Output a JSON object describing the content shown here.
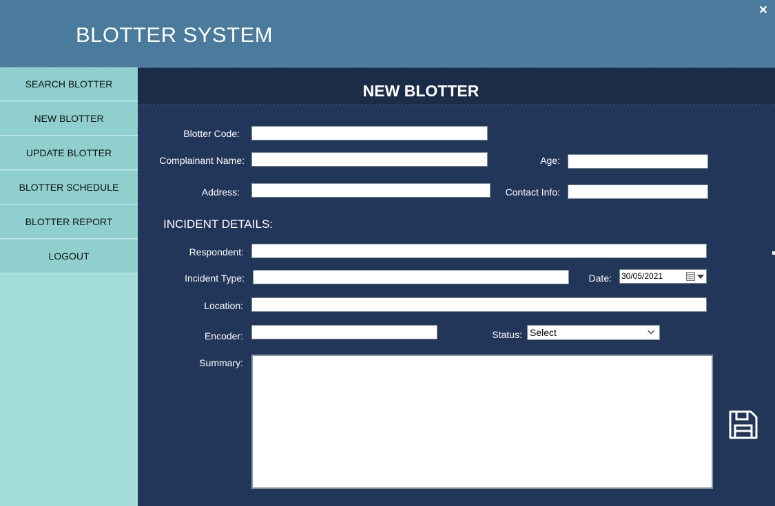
{
  "app": {
    "title": "BLOTTER SYSTEM",
    "close_label": "×"
  },
  "sidebar": {
    "items": [
      {
        "label": "SEARCH BLOTTER"
      },
      {
        "label": "NEW BLOTTER"
      },
      {
        "label": "UPDATE BLOTTER"
      },
      {
        "label": "BLOTTER SCHEDULE"
      },
      {
        "label": "BLOTTER REPORT"
      },
      {
        "label": "LOGOUT"
      }
    ]
  },
  "page": {
    "title": "NEW BLOTTER"
  },
  "form": {
    "blotter_code": {
      "label": "Blotter Code:",
      "value": ""
    },
    "complainant_name": {
      "label": "Complainant Name:",
      "value": ""
    },
    "age": {
      "label": "Age:",
      "value": ""
    },
    "address": {
      "label": "Address:",
      "value": ""
    },
    "contact_info": {
      "label": "Contact Info:",
      "value": ""
    },
    "incident_heading": "INCIDENT DETAILS:",
    "respondent": {
      "label": "Respondent:",
      "value": ""
    },
    "incident_type": {
      "label": "Incident Type:",
      "value": ""
    },
    "date": {
      "label": "Date:",
      "value": "30/05/2021"
    },
    "location": {
      "label": "Location:",
      "value": ""
    },
    "encoder": {
      "label": "Encoder:",
      "value": ""
    },
    "status": {
      "label": "Status:",
      "value": "Select"
    },
    "summary": {
      "label": "Summary:",
      "value": ""
    }
  },
  "icons": {
    "save": "floppy-disk-icon",
    "calendar": "calendar-icon",
    "dropdown": "chevron-down-icon",
    "close": "close-icon"
  },
  "colors": {
    "header": "#4a7a9c",
    "sidebar": "#a5dcdc",
    "sidebar_item": "#8fcfcd",
    "main": "#223659",
    "main_header": "#1b2c48"
  }
}
